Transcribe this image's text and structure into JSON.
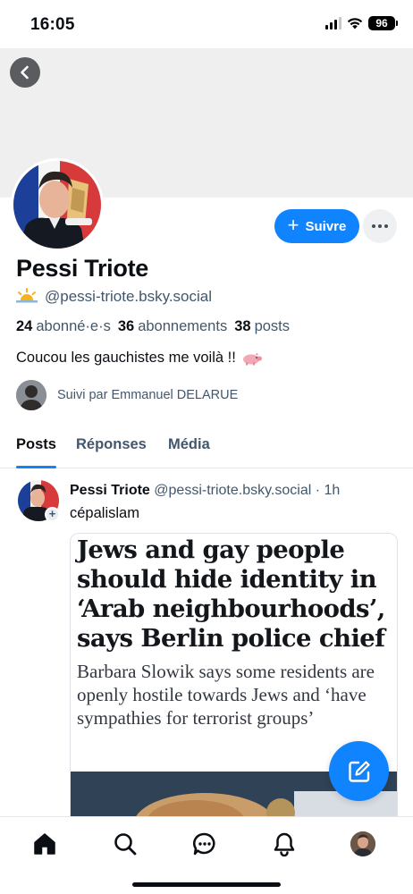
{
  "status_bar": {
    "time": "16:05",
    "battery": "96"
  },
  "profile": {
    "display_name": "Pessi Triote",
    "handle": "@pessi-triote.bsky.social",
    "follow_label": "Suivre",
    "stats": {
      "followers_count": "24",
      "followers_label": "abonné·e·s",
      "following_count": "36",
      "following_label": "abonnements",
      "posts_count": "38",
      "posts_label": "posts"
    },
    "bio": "Coucou les gauchistes me voilà !!",
    "followed_by": "Suivi par Emmanuel DELARUE"
  },
  "tabs": [
    {
      "label": "Posts",
      "active": true
    },
    {
      "label": "Réponses",
      "active": false
    },
    {
      "label": "Média",
      "active": false
    }
  ],
  "post": {
    "author": "Pessi Triote",
    "handle": "@pessi-triote.bsky.social",
    "time": "1h",
    "text": "cépalislam",
    "embed": {
      "title": "Jews and gay people should hide identity in ‘Arab neighbourhoods’, says Berlin police chief",
      "description": "Barbara Slowik says some residents are openly hostile towards Jews and ‘have sympathies for terrorist groups’"
    }
  },
  "colors": {
    "accent": "#1083fe",
    "muted_text": "#42576c",
    "banner": "#efeff0"
  },
  "icons": {
    "back": "chevron-left-icon",
    "more": "ellipsis-icon",
    "compose": "compose-icon",
    "nav": [
      "home-icon",
      "search-icon",
      "chat-icon",
      "bell-icon",
      "profile-avatar"
    ]
  }
}
